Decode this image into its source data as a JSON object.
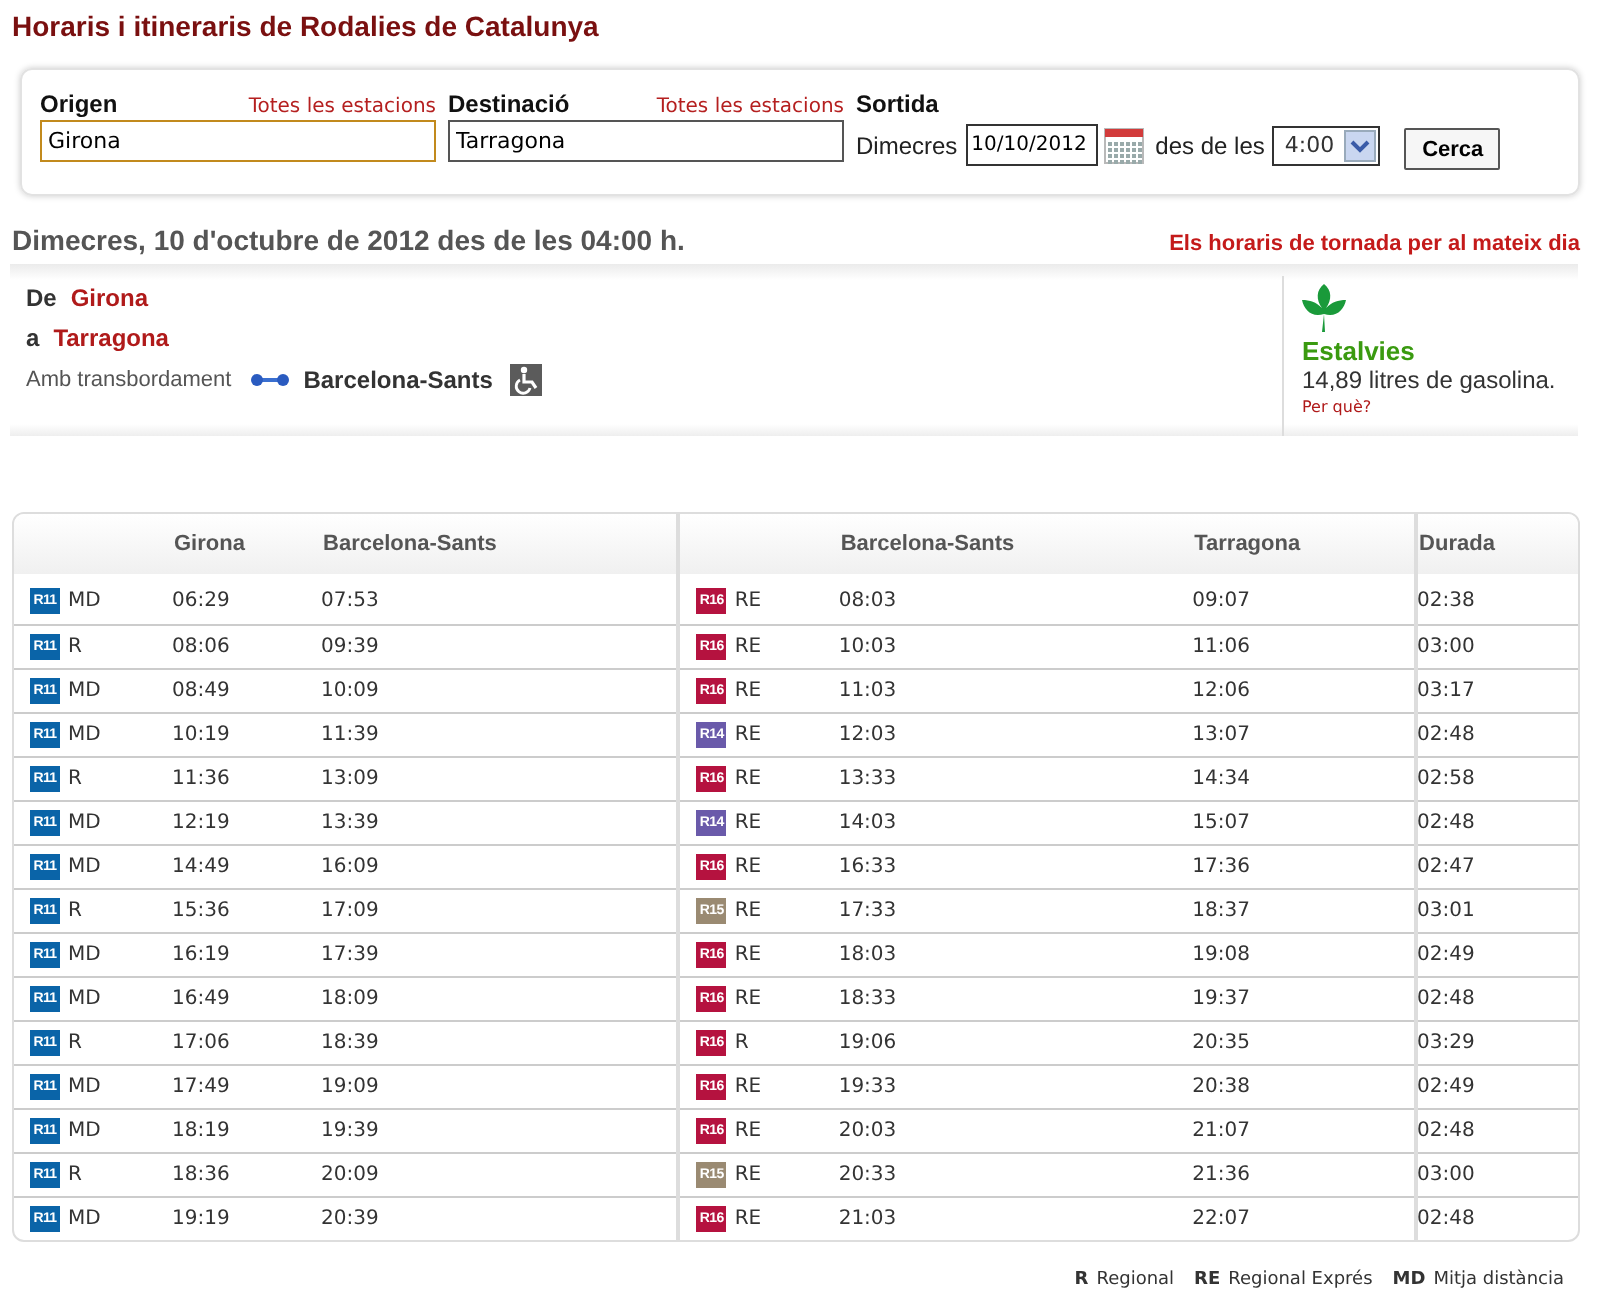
{
  "title": "Horaris i itineraris de Rodalies de Catalunya",
  "form": {
    "origin": {
      "label": "Origen",
      "link": "Totes les estacions",
      "value": "Girona",
      "focused": true
    },
    "destination": {
      "label": "Destinació",
      "link": "Totes les estacions",
      "value": "Tarragona",
      "focused": false
    },
    "departure": {
      "label": "Sortida",
      "day": "Dimecres",
      "date": "10/10/2012",
      "from_label": "des de les",
      "time": "4:00"
    },
    "search_button": "Cerca"
  },
  "result_heading": "Dimecres, 10 d'octubre de 2012 des de les 04:00 h.",
  "return_link": "Els horaris de tornada per al mateix dia",
  "route": {
    "from_label": "De",
    "from": "Girona",
    "to_label": "a",
    "to": "Tarragona",
    "transfer_label": "Amb transbordament",
    "transfer_station": "Barcelona-Sants",
    "accessible": true
  },
  "savings": {
    "title": "Estalvies",
    "text": "14,89 litres de gasolina.",
    "link": "Per què?"
  },
  "table": {
    "columns": [
      "Girona",
      "Barcelona-Sants",
      "Barcelona-Sants",
      "Tarragona",
      "Durada"
    ],
    "rows": [
      {
        "leg1": {
          "line": "R11",
          "color": "#0a64a8",
          "type": "MD",
          "depart": "06:29",
          "arrive": "07:53"
        },
        "leg2": {
          "line": "R16",
          "color": "#b5123f",
          "type": "RE",
          "depart": "08:03",
          "arrive": "09:07"
        },
        "duration": "02:38"
      },
      {
        "leg1": {
          "line": "R11",
          "color": "#0a64a8",
          "type": "R",
          "depart": "08:06",
          "arrive": "09:39"
        },
        "leg2": {
          "line": "R16",
          "color": "#b5123f",
          "type": "RE",
          "depart": "10:03",
          "arrive": "11:06"
        },
        "duration": "03:00"
      },
      {
        "leg1": {
          "line": "R11",
          "color": "#0a64a8",
          "type": "MD",
          "depart": "08:49",
          "arrive": "10:09"
        },
        "leg2": {
          "line": "R16",
          "color": "#b5123f",
          "type": "RE",
          "depart": "11:03",
          "arrive": "12:06"
        },
        "duration": "03:17"
      },
      {
        "leg1": {
          "line": "R11",
          "color": "#0a64a8",
          "type": "MD",
          "depart": "10:19",
          "arrive": "11:39"
        },
        "leg2": {
          "line": "R14",
          "color": "#6a5aaa",
          "type": "RE",
          "depart": "12:03",
          "arrive": "13:07"
        },
        "duration": "02:48"
      },
      {
        "leg1": {
          "line": "R11",
          "color": "#0a64a8",
          "type": "R",
          "depart": "11:36",
          "arrive": "13:09"
        },
        "leg2": {
          "line": "R16",
          "color": "#b5123f",
          "type": "RE",
          "depart": "13:33",
          "arrive": "14:34"
        },
        "duration": "02:58"
      },
      {
        "leg1": {
          "line": "R11",
          "color": "#0a64a8",
          "type": "MD",
          "depart": "12:19",
          "arrive": "13:39"
        },
        "leg2": {
          "line": "R14",
          "color": "#6a5aaa",
          "type": "RE",
          "depart": "14:03",
          "arrive": "15:07"
        },
        "duration": "02:48"
      },
      {
        "leg1": {
          "line": "R11",
          "color": "#0a64a8",
          "type": "MD",
          "depart": "14:49",
          "arrive": "16:09"
        },
        "leg2": {
          "line": "R16",
          "color": "#b5123f",
          "type": "RE",
          "depart": "16:33",
          "arrive": "17:36"
        },
        "duration": "02:47"
      },
      {
        "leg1": {
          "line": "R11",
          "color": "#0a64a8",
          "type": "R",
          "depart": "15:36",
          "arrive": "17:09"
        },
        "leg2": {
          "line": "R15",
          "color": "#9a8a72",
          "type": "RE",
          "depart": "17:33",
          "arrive": "18:37"
        },
        "duration": "03:01"
      },
      {
        "leg1": {
          "line": "R11",
          "color": "#0a64a8",
          "type": "MD",
          "depart": "16:19",
          "arrive": "17:39"
        },
        "leg2": {
          "line": "R16",
          "color": "#b5123f",
          "type": "RE",
          "depart": "18:03",
          "arrive": "19:08"
        },
        "duration": "02:49"
      },
      {
        "leg1": {
          "line": "R11",
          "color": "#0a64a8",
          "type": "MD",
          "depart": "16:49",
          "arrive": "18:09"
        },
        "leg2": {
          "line": "R16",
          "color": "#b5123f",
          "type": "RE",
          "depart": "18:33",
          "arrive": "19:37"
        },
        "duration": "02:48"
      },
      {
        "leg1": {
          "line": "R11",
          "color": "#0a64a8",
          "type": "R",
          "depart": "17:06",
          "arrive": "18:39"
        },
        "leg2": {
          "line": "R16",
          "color": "#b5123f",
          "type": "R",
          "depart": "19:06",
          "arrive": "20:35"
        },
        "duration": "03:29"
      },
      {
        "leg1": {
          "line": "R11",
          "color": "#0a64a8",
          "type": "MD",
          "depart": "17:49",
          "arrive": "19:09"
        },
        "leg2": {
          "line": "R16",
          "color": "#b5123f",
          "type": "RE",
          "depart": "19:33",
          "arrive": "20:38"
        },
        "duration": "02:49"
      },
      {
        "leg1": {
          "line": "R11",
          "color": "#0a64a8",
          "type": "MD",
          "depart": "18:19",
          "arrive": "19:39"
        },
        "leg2": {
          "line": "R16",
          "color": "#b5123f",
          "type": "RE",
          "depart": "20:03",
          "arrive": "21:07"
        },
        "duration": "02:48"
      },
      {
        "leg1": {
          "line": "R11",
          "color": "#0a64a8",
          "type": "R",
          "depart": "18:36",
          "arrive": "20:09"
        },
        "leg2": {
          "line": "R15",
          "color": "#9a8a72",
          "type": "RE",
          "depart": "20:33",
          "arrive": "21:36"
        },
        "duration": "03:00"
      },
      {
        "leg1": {
          "line": "R11",
          "color": "#0a64a8",
          "type": "MD",
          "depart": "19:19",
          "arrive": "20:39"
        },
        "leg2": {
          "line": "R16",
          "color": "#b5123f",
          "type": "RE",
          "depart": "21:03",
          "arrive": "22:07"
        },
        "duration": "02:48"
      }
    ]
  },
  "legend": [
    {
      "code": "R",
      "name": "Regional"
    },
    {
      "code": "RE",
      "name": "Regional Exprés"
    },
    {
      "code": "MD",
      "name": "Mitja distància"
    }
  ]
}
